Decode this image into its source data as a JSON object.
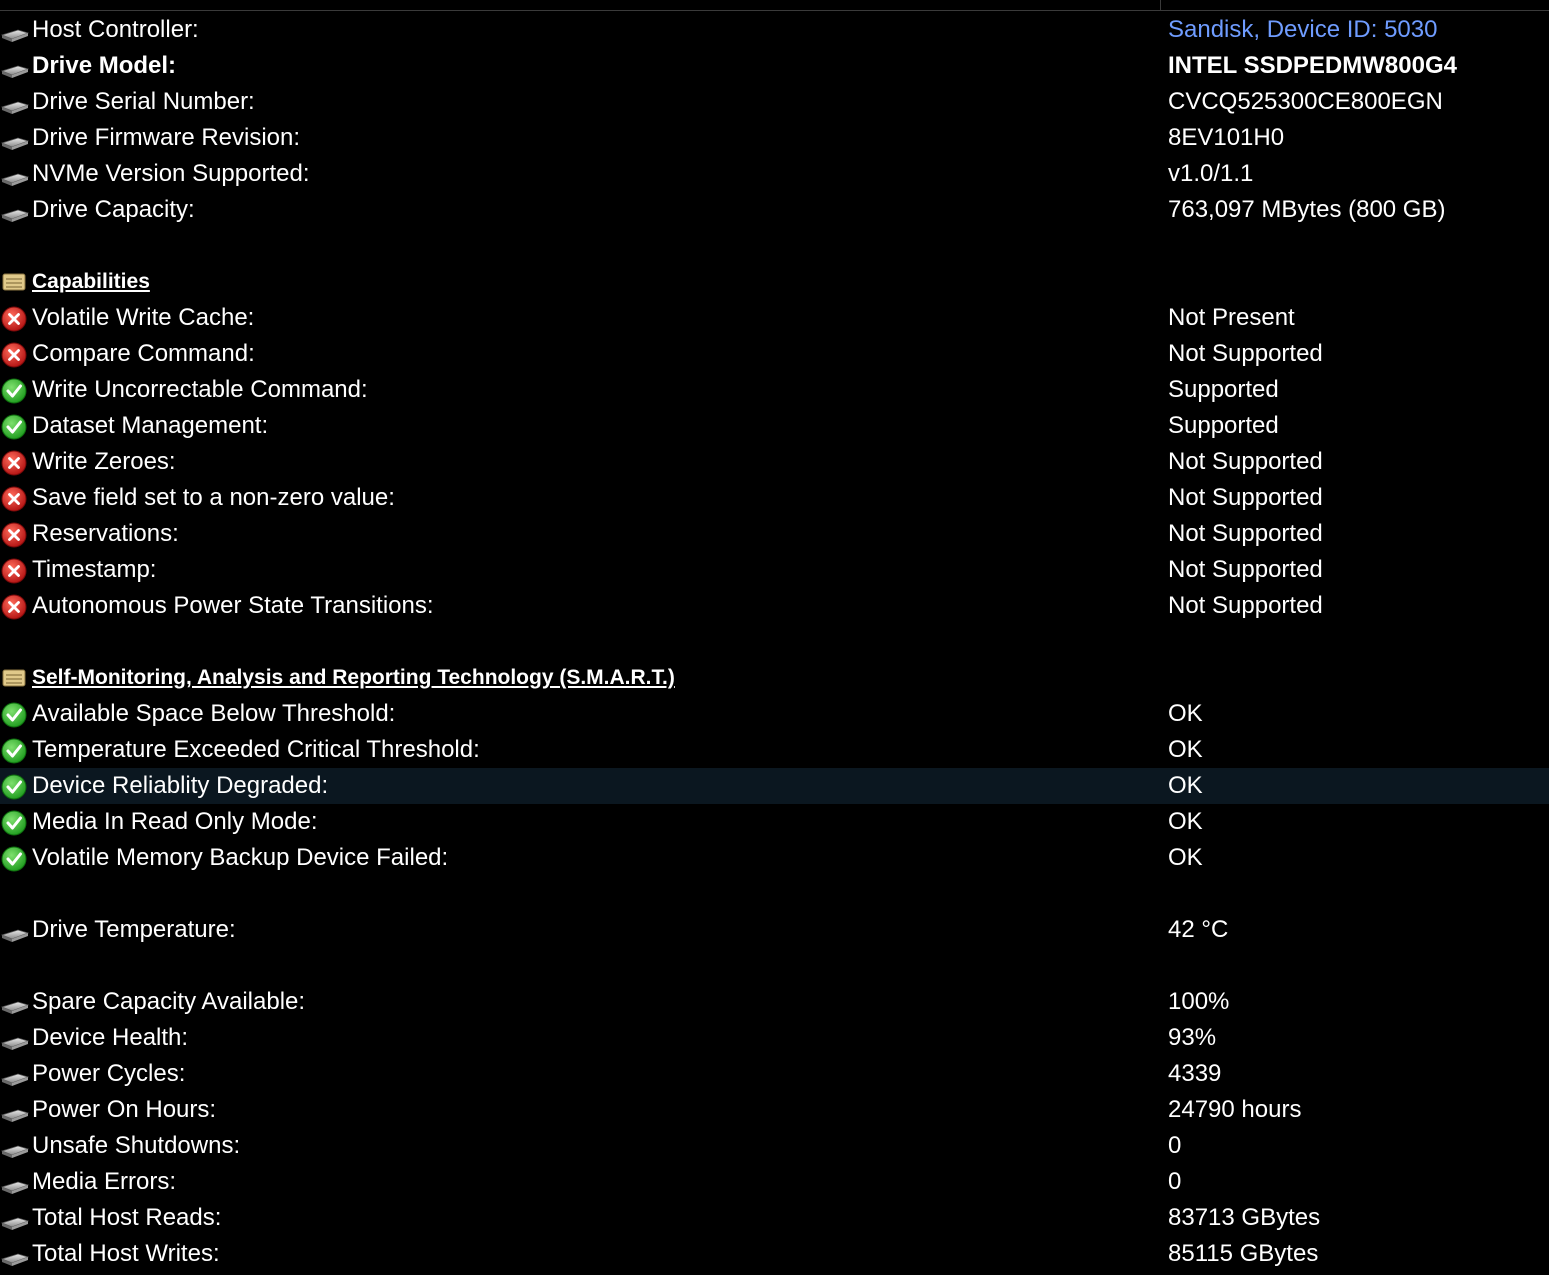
{
  "colors": {
    "background": "#000000",
    "text": "#ffffff",
    "link": "#6f9cff",
    "ok_green": "#2bb52b",
    "error_red": "#d22020",
    "row_highlight": "#0b1720"
  },
  "drive_info": [
    {
      "icon": "drive-icon",
      "label": "Host Controller:",
      "value": "Sandisk, Device ID: 5030"
    },
    {
      "icon": "drive-icon",
      "label": "Drive Model:",
      "value": "INTEL SSDPEDMW800G4"
    },
    {
      "icon": "drive-icon",
      "label": "Drive Serial Number:",
      "value": "CVCQ525300CE800EGN"
    },
    {
      "icon": "drive-icon",
      "label": "Drive Firmware Revision:",
      "value": "8EV101H0"
    },
    {
      "icon": "drive-icon",
      "label": "NVMe Version Supported:",
      "value": "v1.0/1.1"
    },
    {
      "icon": "drive-icon",
      "label": "Drive Capacity:",
      "value": "763,097 MBytes (800 GB)"
    }
  ],
  "capabilities": {
    "heading": "Capabilities",
    "items": [
      {
        "icon": "error-icon",
        "label": "Volatile Write Cache:",
        "value": "Not Present"
      },
      {
        "icon": "error-icon",
        "label": "Compare Command:",
        "value": "Not Supported"
      },
      {
        "icon": "ok-icon",
        "label": "Write Uncorrectable Command:",
        "value": "Supported"
      },
      {
        "icon": "ok-icon",
        "label": "Dataset Management:",
        "value": "Supported"
      },
      {
        "icon": "error-icon",
        "label": "Write Zeroes:",
        "value": "Not Supported"
      },
      {
        "icon": "error-icon",
        "label": "Save field set to a non-zero value:",
        "value": "Not Supported"
      },
      {
        "icon": "error-icon",
        "label": "Reservations:",
        "value": "Not Supported"
      },
      {
        "icon": "error-icon",
        "label": "Timestamp:",
        "value": "Not Supported"
      },
      {
        "icon": "error-icon",
        "label": "Autonomous Power State Transitions:",
        "value": "Not Supported"
      }
    ]
  },
  "smart": {
    "heading": "Self-Monitoring, Analysis and Reporting Technology (S.M.A.R.T.)",
    "items": [
      {
        "icon": "ok-icon",
        "label": "Available Space Below Threshold:",
        "value": "OK"
      },
      {
        "icon": "ok-icon",
        "label": "Temperature Exceeded Critical Threshold:",
        "value": "OK"
      },
      {
        "icon": "ok-icon",
        "label": "Device Reliablity Degraded:",
        "value": "OK"
      },
      {
        "icon": "ok-icon",
        "label": "Media In Read Only Mode:",
        "value": "OK"
      },
      {
        "icon": "ok-icon",
        "label": "Volatile Memory Backup Device Failed:",
        "value": "OK"
      }
    ],
    "temperature": {
      "icon": "drive-icon",
      "label": "Drive Temperature:",
      "value": "42 °C"
    },
    "stats": [
      {
        "icon": "drive-icon",
        "label": "Spare Capacity Available:",
        "value": "100%"
      },
      {
        "icon": "drive-icon",
        "label": "Device Health:",
        "value": "93%"
      },
      {
        "icon": "drive-icon",
        "label": "Power Cycles:",
        "value": "4339"
      },
      {
        "icon": "drive-icon",
        "label": "Power On Hours:",
        "value": "24790 hours"
      },
      {
        "icon": "drive-icon",
        "label": "Unsafe Shutdowns:",
        "value": "0"
      },
      {
        "icon": "drive-icon",
        "label": "Media Errors:",
        "value": "0"
      },
      {
        "icon": "drive-icon",
        "label": "Total Host Reads:",
        "value": "83713 GBytes"
      },
      {
        "icon": "drive-icon",
        "label": "Total Host Writes:",
        "value": "85115 GBytes"
      }
    ]
  }
}
